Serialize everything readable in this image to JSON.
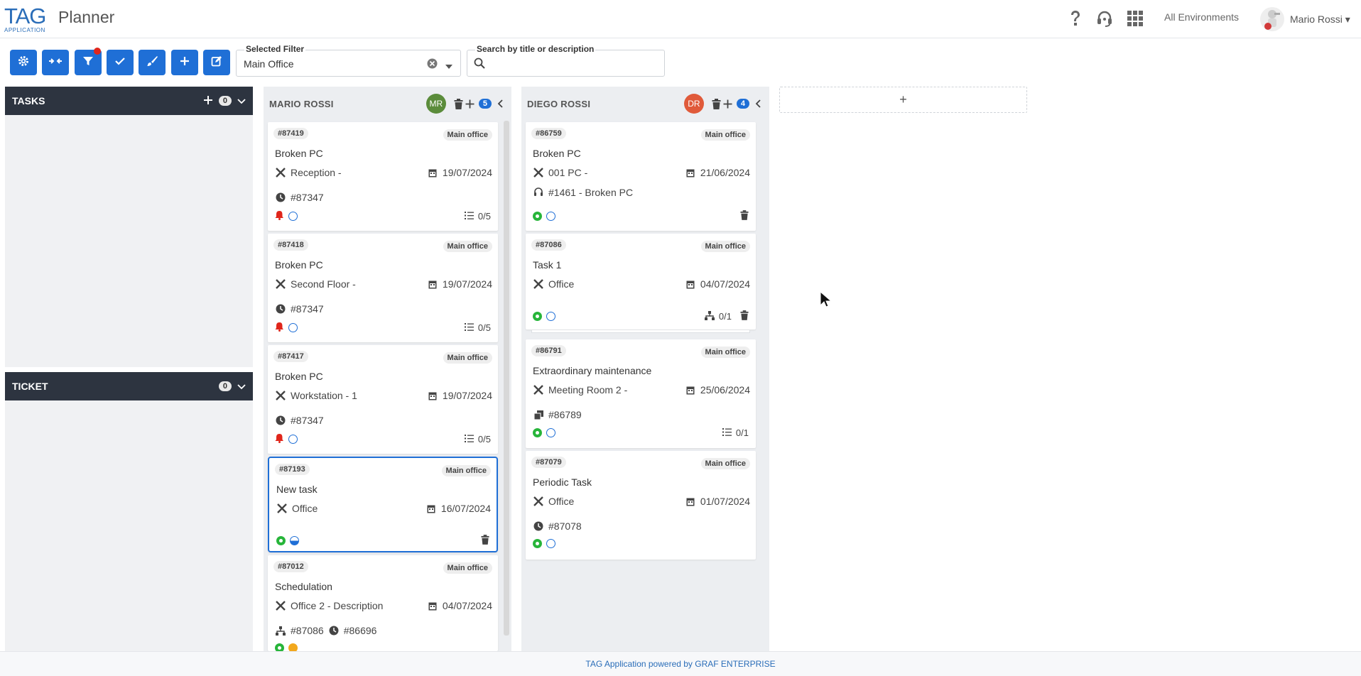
{
  "header": {
    "logo_big": "TAG",
    "logo_small": "APPLICATION",
    "title": "Planner",
    "environment": "All Environments",
    "user_name": "Mario Rossi ▾"
  },
  "toolbar": {
    "buttons": [
      "settings",
      "merge",
      "filter",
      "check",
      "brush",
      "add",
      "edit"
    ],
    "filter_label": "Selected Filter",
    "filter_value": "Main Office",
    "search_label": "Search by title or description",
    "search_value": ""
  },
  "panels": {
    "tasks": {
      "title": "TASKS",
      "count": "0"
    },
    "ticket": {
      "title": "TICKET",
      "count": "0"
    }
  },
  "columns": [
    {
      "name": "MARIO ROSSI",
      "initials": "MR",
      "avatar_color": "#5b8c3b",
      "count": "5",
      "cards": [
        {
          "id": "#87419",
          "office": "Main office",
          "title": "Broken PC",
          "location": "Reception -",
          "date": "19/07/2024",
          "ref": "#87347",
          "progress": "0/5"
        },
        {
          "id": "#87418",
          "office": "Main office",
          "title": "Broken PC",
          "location": "Second Floor -",
          "date": "19/07/2024",
          "ref": "#87347",
          "progress": "0/5"
        },
        {
          "id": "#87417",
          "office": "Main office",
          "title": "Broken PC",
          "location": "Workstation - 1",
          "date": "19/07/2024",
          "ref": "#87347",
          "progress": "0/5"
        },
        {
          "id": "#87193",
          "office": "Main office",
          "title": "New task",
          "location": "Office",
          "date": "16/07/2024"
        },
        {
          "id": "#87012",
          "office": "Main office",
          "title": "Schedulation",
          "location": "Office 2 - Description",
          "date": "04/07/2024",
          "ref1": "#87086",
          "ref2": "#86696"
        }
      ]
    },
    {
      "name": "DIEGO ROSSI",
      "initials": "DR",
      "avatar_color": "#e05a3a",
      "count": "4",
      "cards": [
        {
          "id": "#86759",
          "office": "Main office",
          "title": "Broken PC",
          "location": "001 PC -",
          "date": "21/06/2024",
          "ticket": "#1461 - Broken PC"
        },
        {
          "id": "#87086",
          "office": "Main office",
          "title": "Task 1",
          "location": "Office",
          "date": "04/07/2024",
          "progress": "0/1"
        },
        {
          "id": "#86791",
          "office": "Main office",
          "title": "Extraordinary maintenance",
          "location": "Meeting Room 2 -",
          "date": "25/06/2024",
          "ref": "#86789",
          "progress": "0/1"
        },
        {
          "id": "#87079",
          "office": "Main office",
          "title": "Periodic Task",
          "location": "Office",
          "date": "01/07/2024",
          "ref": "#87078"
        }
      ]
    }
  ],
  "add_column_label": "+",
  "footer": "TAG Application powered by GRAF ENTERPRISE"
}
